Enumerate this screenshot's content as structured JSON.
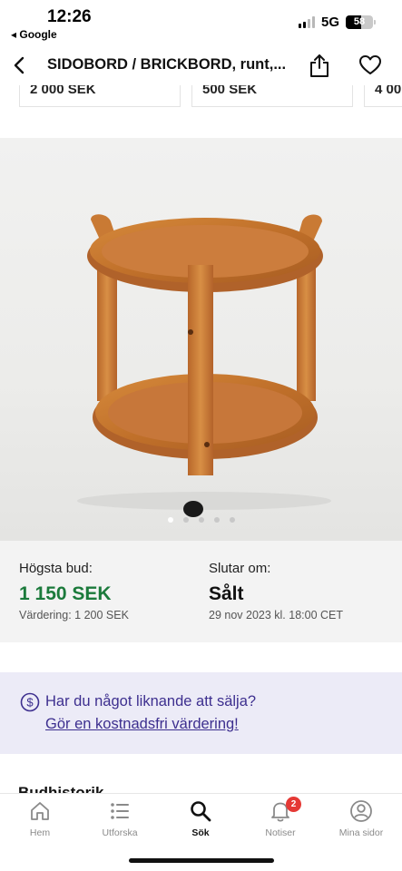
{
  "status_bar": {
    "time": "12:26",
    "back_app": "◂ Google",
    "network": "5G",
    "battery": "58"
  },
  "nav": {
    "title": "SIDOBORD / BRICKBORD, runt,..."
  },
  "related_cards": [
    {
      "price": "2 000 SEK"
    },
    {
      "price": "500 SEK"
    },
    {
      "price": "4 00"
    }
  ],
  "gallery": {
    "image_count": 5,
    "active_index": 0
  },
  "bid": {
    "highest_label": "Högsta bud:",
    "highest_value": "1 150 SEK",
    "valuation": "Värdering: 1 200 SEK",
    "ends_label": "Slutar om:",
    "ends_value": "Sålt",
    "ends_date": "29 nov 2023 kl. 18:00 CET"
  },
  "sell_banner": {
    "text": "Har du något liknande att sälja?",
    "link": "Gör en kostnadsfri värdering!"
  },
  "partial_heading": "Budhistorik",
  "tabbar": {
    "items": [
      {
        "label": "Hem",
        "icon": "home-icon"
      },
      {
        "label": "Utforska",
        "icon": "list-icon"
      },
      {
        "label": "Sök",
        "icon": "search-icon"
      },
      {
        "label": "Notiser",
        "icon": "bell-icon",
        "badge": "2"
      },
      {
        "label": "Mina sidor",
        "icon": "user-icon"
      }
    ],
    "active": "Sök"
  },
  "colors": {
    "price_green": "#1b7a3b",
    "banner_bg": "#ecebf7",
    "banner_text": "#3d2f8f",
    "badge_red": "#e53935"
  }
}
